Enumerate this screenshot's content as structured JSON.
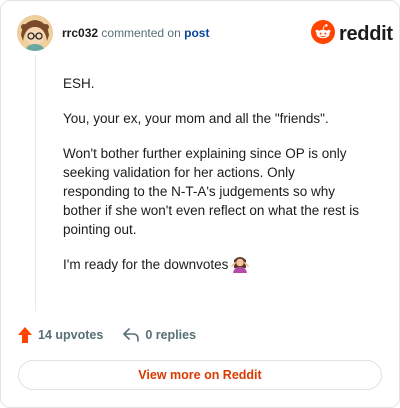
{
  "comment": {
    "username": "rrc032",
    "commented_text": "commented on",
    "post_link": "post",
    "brand": "reddit",
    "body": [
      "ESH.",
      "You, your ex, your mom and all the \"friends\".",
      "Won't bother further explaining since OP is only seeking validation for her actions. Only responding to the N-T-A's judgements so why bother if she won't even reflect on what the rest is pointing out.",
      "I'm ready for the downvotes"
    ],
    "upvotes": "14 upvotes",
    "replies": "0 replies",
    "view_more": "View more on Reddit"
  },
  "colors": {
    "brand_orange": "#ff4500",
    "link_blue": "#0a449b",
    "view_more_text": "#d93a00"
  },
  "icons": [
    "avatar",
    "reddit-logo-icon",
    "upvote-arrow-icon",
    "reply-arrow-icon",
    "woman-shrugging-emoji"
  ]
}
